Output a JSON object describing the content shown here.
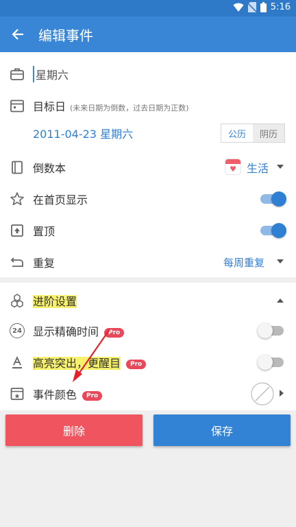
{
  "status": {
    "time": "5:16"
  },
  "appbar": {
    "title": "编辑事件"
  },
  "event": {
    "name_value": "星期六"
  },
  "target": {
    "label": "目标日",
    "hint": "(未来日期为倒数，过去日期为正数)",
    "date": "2011-04-23 星期六",
    "calendar_options": [
      "公历",
      "阴历"
    ],
    "selected_calendar": "公历"
  },
  "book": {
    "label": "倒数本",
    "value": "生活"
  },
  "show_home": {
    "label": "在首页显示",
    "on": true
  },
  "pin": {
    "label": "置顶",
    "on": true
  },
  "repeat": {
    "label": "重复",
    "value": "每周重复"
  },
  "advanced": {
    "label": "进阶设置",
    "exact_time": {
      "label": "显示精确时间",
      "badge": "Pro",
      "on": false
    },
    "highlight": {
      "label": "高亮突出，更醒目",
      "badge": "Pro",
      "on": false
    },
    "color": {
      "label": "事件颜色",
      "badge": "Pro"
    },
    "counter_icon_text": "24"
  },
  "actions": {
    "delete": "删除",
    "save": "保存"
  },
  "colors": {
    "primary": "#3a86d6",
    "danger": "#ef545f",
    "save": "#3282d6",
    "highlight": "#f7f06a",
    "pro": "#e8485a"
  }
}
